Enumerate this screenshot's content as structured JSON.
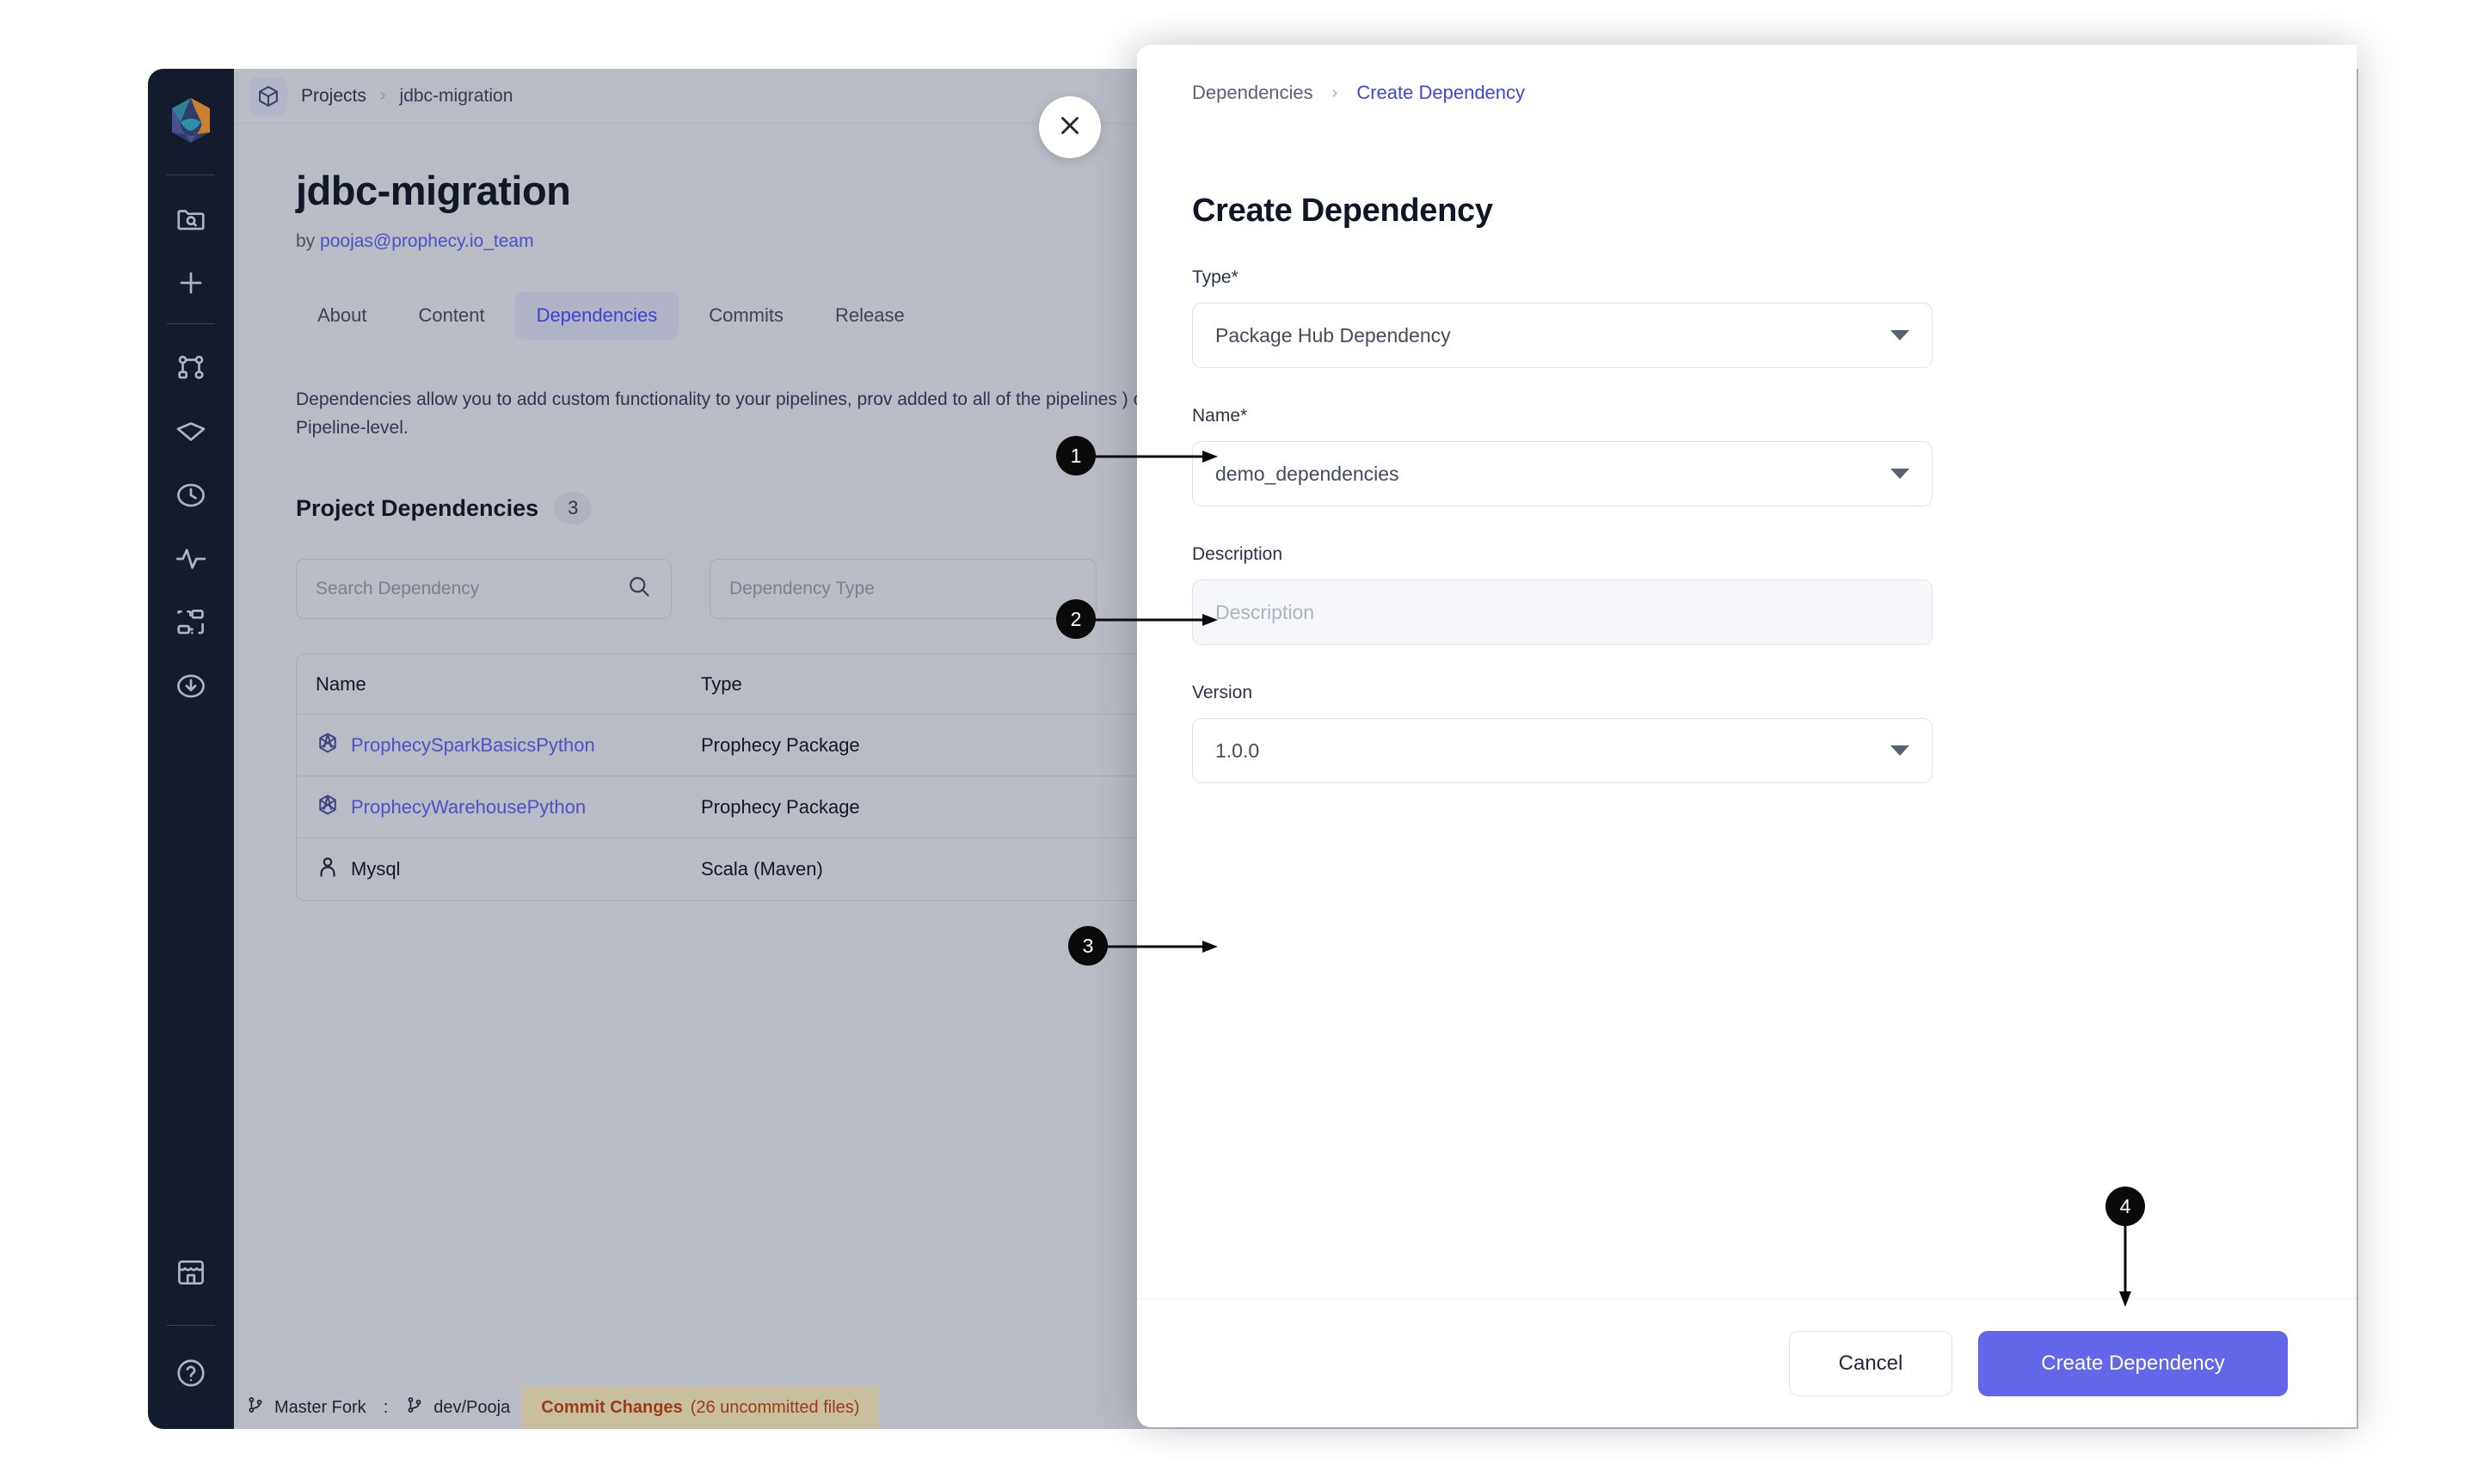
{
  "app": {
    "rail": {
      "logo_name": "prophecy-logo",
      "items": [
        {
          "id": "search-project",
          "icon": "folder-search-icon"
        },
        {
          "id": "new",
          "icon": "plus-icon"
        },
        {
          "id": "pipelines",
          "icon": "pipeline-graph-icon"
        },
        {
          "id": "gems",
          "icon": "gem-icon"
        },
        {
          "id": "history",
          "icon": "clock-icon"
        },
        {
          "id": "monitoring",
          "icon": "activity-pulse-icon"
        },
        {
          "id": "jobs",
          "icon": "workflow-nodes-icon"
        },
        {
          "id": "downloads",
          "icon": "download-circle-icon"
        },
        {
          "id": "marketplace",
          "icon": "store-icon"
        },
        {
          "id": "help",
          "icon": "help-circle-icon"
        }
      ]
    },
    "breadcrumb": {
      "cube_icon": "cube-icon",
      "root": "Projects",
      "separator": "›",
      "current": "jdbc-migration"
    },
    "project": {
      "title": "jdbc-migration",
      "by_prefix": "by",
      "owner": "poojas@prophecy.io_team"
    },
    "tabs": [
      {
        "label": "About",
        "active": false
      },
      {
        "label": "Content",
        "active": false
      },
      {
        "label": "Dependencies",
        "active": true
      },
      {
        "label": "Commits",
        "active": false
      },
      {
        "label": "Release",
        "active": false
      }
    ],
    "dependencies_page": {
      "description": "Dependencies allow you to add custom functionality to your pipelines, prov added to all of the pipelines ) or Pipeline-level.",
      "section_title": "Project Dependencies",
      "section_count": "3",
      "search_placeholder": "Search Dependency",
      "search_icon": "search-icon",
      "type_filter_placeholder": "Dependency Type",
      "table": {
        "columns": [
          "Name",
          "Type"
        ],
        "rows": [
          {
            "name": "ProphecySparkBasicsPython",
            "type": "Prophecy Package",
            "icon": "package-hex-icon",
            "is_link": true
          },
          {
            "name": "ProphecyWarehousePython",
            "type": "Prophecy Package",
            "icon": "package-hex-icon",
            "is_link": true
          },
          {
            "name": "Mysql",
            "type": "Scala (Maven)",
            "icon": "person-icon",
            "is_link": false
          }
        ]
      }
    },
    "statusbar": {
      "fork_icon": "git-branch-icon",
      "fork_label": "Master Fork",
      "colon": ":",
      "branch_icon": "git-branch-icon",
      "branch_label": "dev/Pooja",
      "commit_label": "Commit Changes",
      "commit_count": "(26 uncommitted files)"
    }
  },
  "drawer": {
    "close_icon": "close-icon",
    "breadcrumb": {
      "root": "Dependencies",
      "separator": "›",
      "current": "Create Dependency"
    },
    "title": "Create Dependency",
    "fields": [
      {
        "label": "Type*",
        "value": "Package Hub Dependency",
        "control": "select",
        "name": "type-select"
      },
      {
        "label": "Name*",
        "value": "demo_dependencies",
        "control": "select",
        "name": "name-select"
      },
      {
        "label": "Description",
        "value": "",
        "placeholder": "Description",
        "control": "input",
        "name": "description-input"
      },
      {
        "label": "Version",
        "value": "1.0.0",
        "control": "select",
        "name": "version-select"
      }
    ],
    "footer": {
      "cancel_label": "Cancel",
      "submit_label": "Create Dependency"
    }
  },
  "annotations": [
    {
      "number": "1",
      "target": "type-select"
    },
    {
      "number": "2",
      "target": "name-select"
    },
    {
      "number": "3",
      "target": "version-select"
    },
    {
      "number": "4",
      "target": "create-dependency-button"
    }
  ],
  "colors": {
    "accent": "#6366e8",
    "link": "#4f51c9",
    "rail_bg": "#141b2d",
    "app_bg": "#b9bcc4",
    "drawer_bg": "#ffffff",
    "commit_bar_bg": "#c8bf9e",
    "commit_text": "#9e3b16"
  }
}
